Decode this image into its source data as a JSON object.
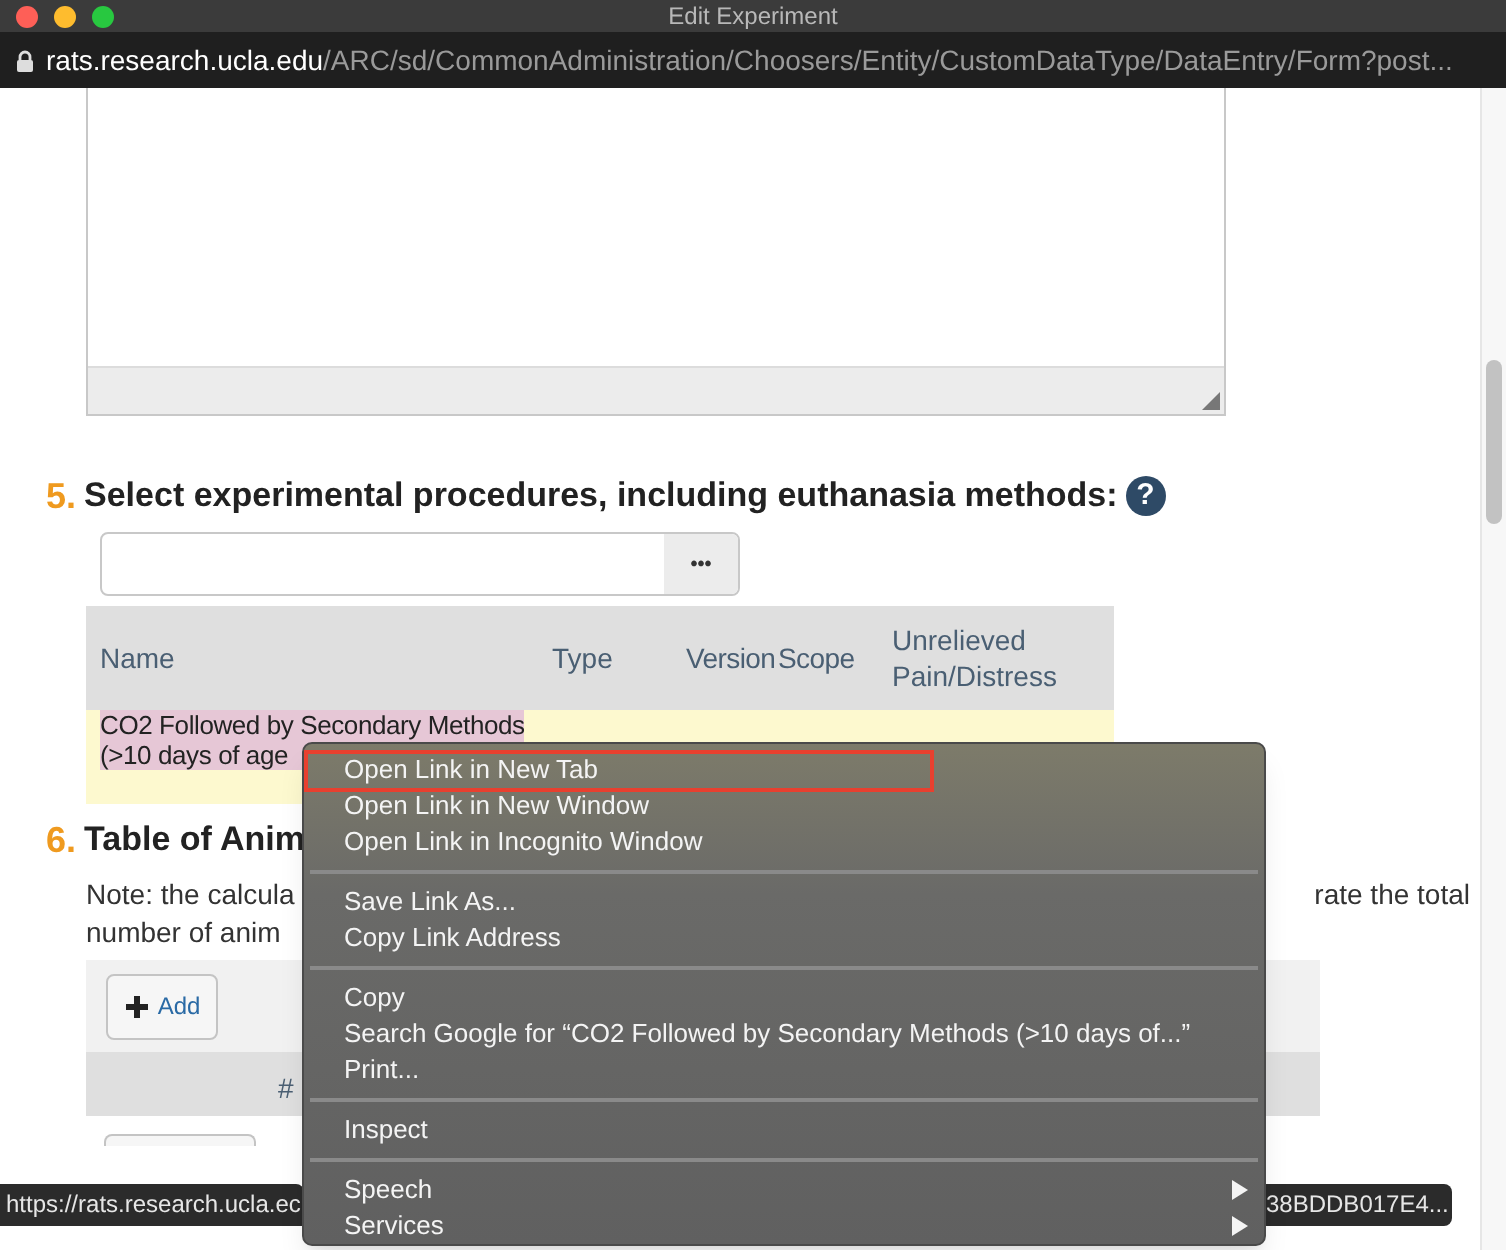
{
  "window": {
    "title": "Edit Experiment"
  },
  "address_bar": {
    "host": "rats.research.ucla.edu",
    "path": "/ARC/sd/CommonAdministration/Choosers/Entity/CustomDataType/DataEntry/Form?post..."
  },
  "section_5": {
    "number": "5.",
    "title": "Select experimental procedures, including euthanasia methods:",
    "help": "?",
    "chooser": {
      "button": "•••"
    },
    "table": {
      "columns": [
        "Name",
        "Type",
        "Version",
        "Scope",
        "Unrelieved Pain/Distress"
      ],
      "rows": [
        {
          "name_lines": [
            "CO2 Followed by Secondary Methods",
            "(>10 days of age"
          ],
          "selected": true
        }
      ]
    }
  },
  "section_6": {
    "number": "6.",
    "title": "Table of Anim",
    "note_left": [
      "Note: the calcula",
      "number of anim"
    ],
    "note_right": "rate the total",
    "add_button": "Add",
    "table": {
      "columns": [
        "#"
      ]
    }
  },
  "context_menu": {
    "groups": [
      [
        {
          "label": "Open Link in New Tab",
          "selected": true,
          "submenu": false
        },
        {
          "label": "Open Link in New Window",
          "selected": false,
          "submenu": false
        },
        {
          "label": "Open Link in Incognito Window",
          "selected": false,
          "submenu": false
        }
      ],
      [
        {
          "label": "Save Link As...",
          "selected": false,
          "submenu": false
        },
        {
          "label": "Copy Link Address",
          "selected": false,
          "submenu": false
        }
      ],
      [
        {
          "label": "Copy",
          "selected": false,
          "submenu": false
        },
        {
          "label": "Search Google for “CO2 Followed by Secondary Methods (>10 days of...”",
          "selected": false,
          "submenu": false
        },
        {
          "label": "Print...",
          "selected": false,
          "submenu": false
        }
      ],
      [
        {
          "label": "Inspect",
          "selected": false,
          "submenu": false
        }
      ],
      [
        {
          "label": "Speech",
          "selected": false,
          "submenu": true
        },
        {
          "label": "Services",
          "selected": false,
          "submenu": true
        }
      ]
    ]
  },
  "status_bar": {
    "left": "https://rats.research.ucla.ec",
    "right": "38BDDB017E4..."
  }
}
